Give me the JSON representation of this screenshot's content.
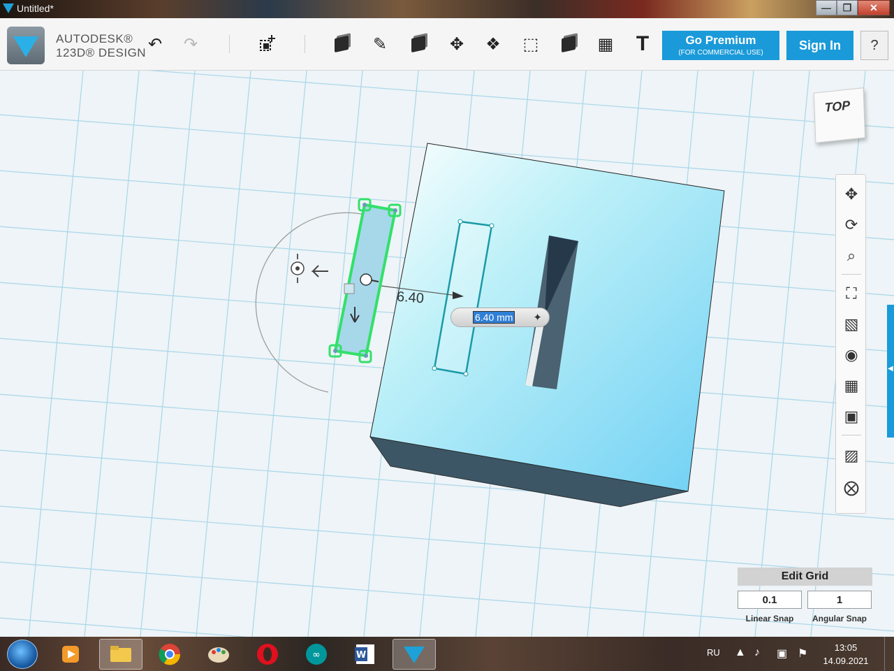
{
  "window": {
    "title": "Untitled*",
    "controls": {
      "minimize": "—",
      "maximize": "❐",
      "close": "✕"
    }
  },
  "app": {
    "brand_line1": "AUTODESK®",
    "brand_line2": "123D® DESIGN"
  },
  "toolbar": {
    "undo_icon": "undo-icon",
    "redo_icon": "redo-icon",
    "tools": [
      "primitives",
      "sketch",
      "construct",
      "modify",
      "pattern",
      "grouping",
      "combine",
      "measure",
      "text"
    ],
    "text_tool_label": "T",
    "premium_label": "Go Premium",
    "premium_sublabel": "(FOR COMMERCIAL USE)",
    "signin_label": "Sign In",
    "help_label": "?",
    "accent": "#1a9ad9"
  },
  "viewport": {
    "dimension_label": "6.40",
    "dimension_input": "6.40 mm",
    "object_color": "#7fd3ee",
    "selection_color": "#33e06a"
  },
  "viewcube": {
    "face_label": "TOP"
  },
  "navbar": {
    "items": [
      "pan",
      "orbit",
      "zoom",
      "fit",
      "view-mode",
      "visibility",
      "grid",
      "screenshot",
      "material",
      "snap"
    ]
  },
  "edit_grid": {
    "title": "Edit Grid",
    "linear_snap_value": "0.1",
    "angular_snap_value": "1",
    "linear_snap_label": "Linear Snap",
    "angular_snap_label": "Angular Snap"
  },
  "taskbar": {
    "apps": [
      "media-player",
      "file-explorer",
      "chrome",
      "paint",
      "opera",
      "arduino",
      "word",
      "123d-design"
    ],
    "language": "RU",
    "time": "13:05",
    "date": "14.09.2021"
  }
}
